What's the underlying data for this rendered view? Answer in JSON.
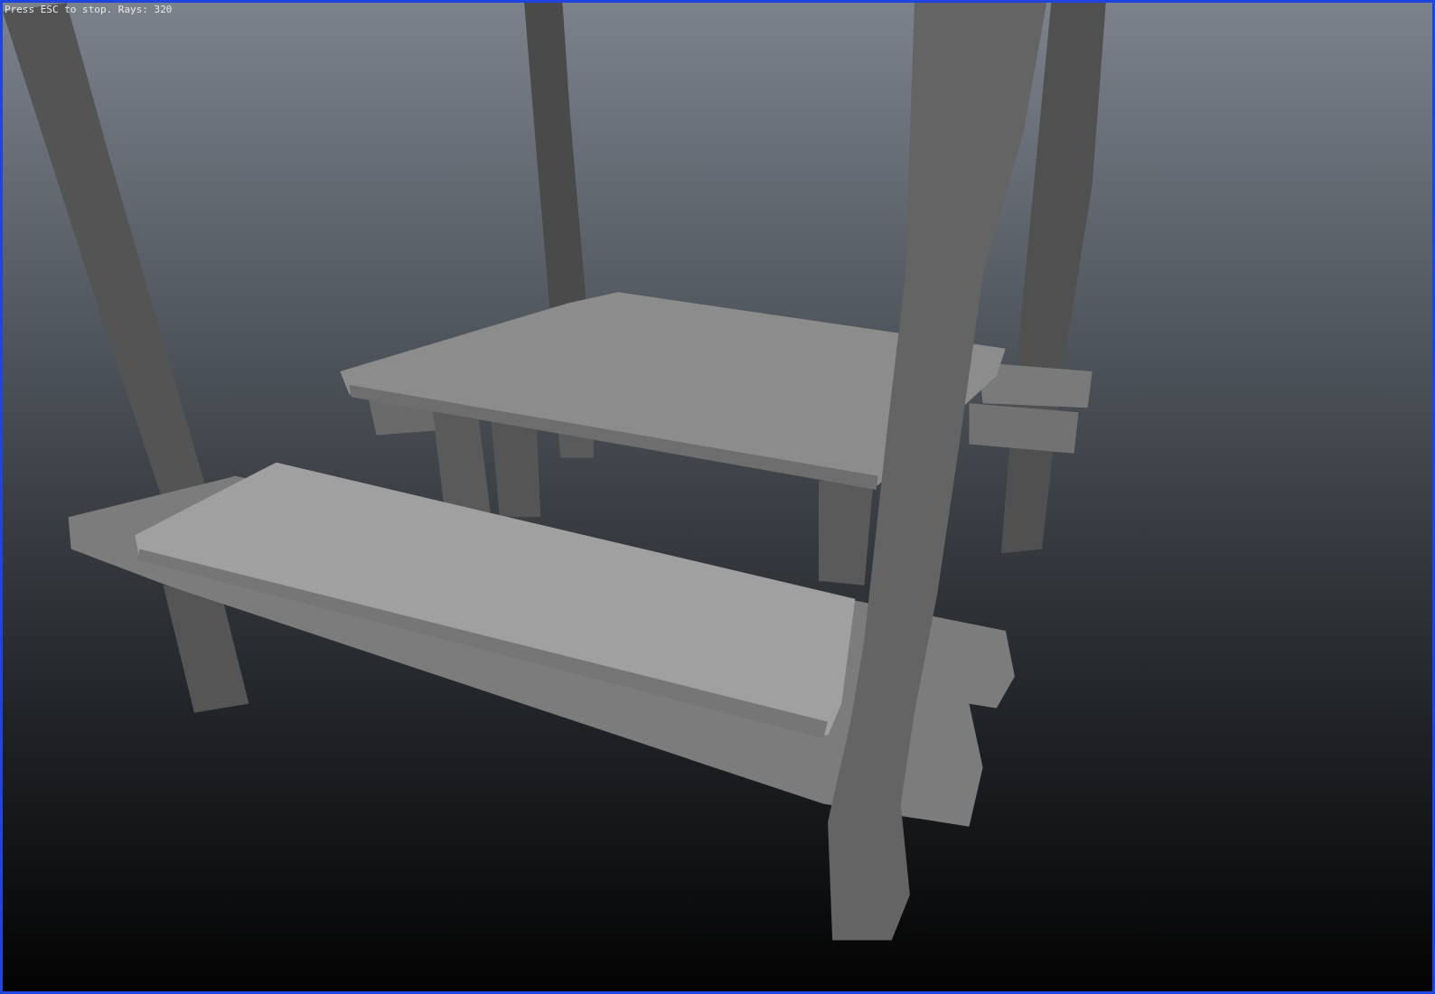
{
  "viewport": {
    "status_text": "Press ESC to stop. Rays: 320"
  }
}
